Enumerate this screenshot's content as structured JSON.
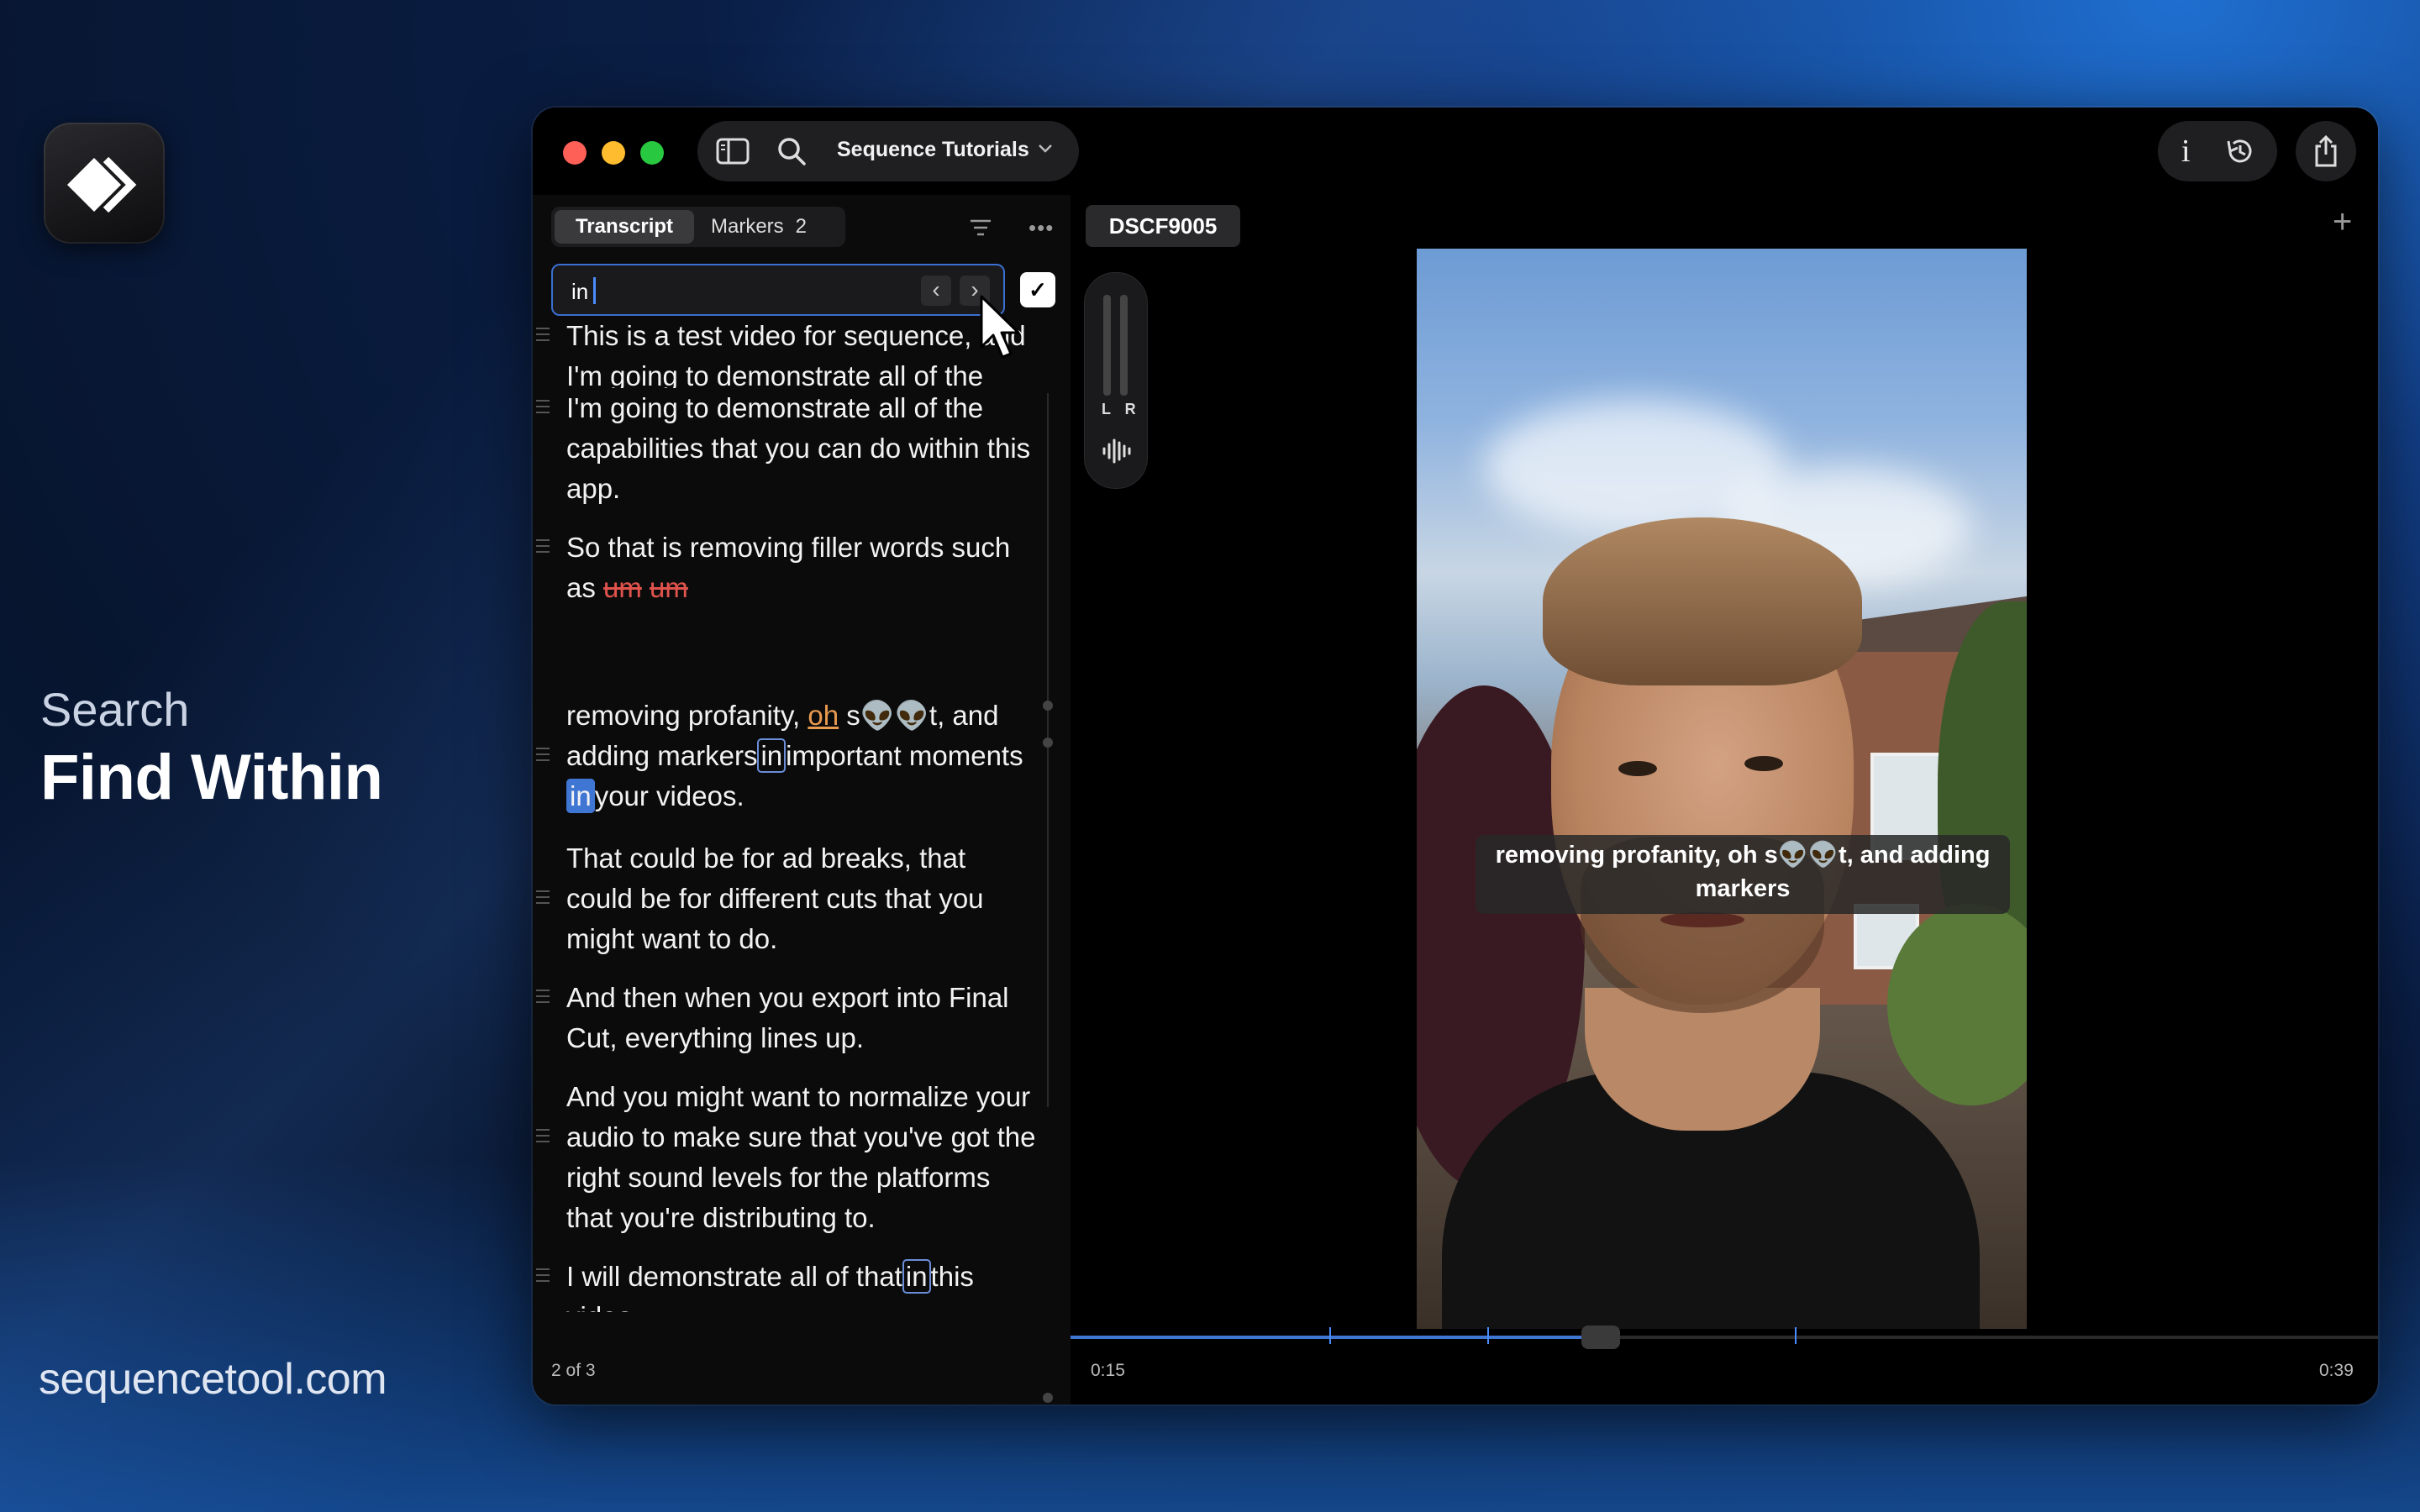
{
  "promo": {
    "feature_category": "Search",
    "feature_name": "Find Within",
    "website": "sequencetool.com"
  },
  "titlebar": {
    "project_name": "Sequence Tutorials",
    "info_label": "i"
  },
  "left_panel": {
    "tabs": [
      {
        "label": "Transcript",
        "active": true
      },
      {
        "label": "Markers",
        "count": "2",
        "active": false
      }
    ],
    "find": {
      "value": "in",
      "prev_label": "‹",
      "next_label": "›",
      "done_label": "✓"
    },
    "status": "2 of 3"
  },
  "transcript": {
    "para1": {
      "top_line": "This is a test video for sequence, and",
      "rest": "I'm going to demonstrate all of the capabilities that you can do within this app."
    },
    "para2": {
      "text": "So that is removing filler words such as",
      "filler_1": "um",
      "filler_2": "um"
    },
    "para3": {
      "a": "removing profanity,",
      "profane": "oh",
      "b": "s👽👽t, and adding",
      "c": "markers",
      "hit1": "in",
      "d": "important moments",
      "hit2": "in",
      "e": "your videos."
    },
    "para4": "That could be for ad breaks, that could be for different cuts that you might want to do.",
    "para5": "And then when you export into Final Cut, everything lines up.",
    "para6": "And you might want to normalize your audio to make sure that you've got the right sound levels for the platforms that you're distributing to.",
    "para7": {
      "a": "I will demonstrate all of that",
      "hit3": "in",
      "b": "this video."
    }
  },
  "viewer": {
    "clip_name": "DSCF9005",
    "meter_label": "L R",
    "caption": "removing profanity, oh s👽👽t, and adding markers",
    "time_current": "0:15",
    "time_total": "0:39",
    "progress": 0.409
  },
  "colors": {
    "accent": "#3f76d4",
    "filler": "#e0534d",
    "profanity": "#e89a4f"
  }
}
